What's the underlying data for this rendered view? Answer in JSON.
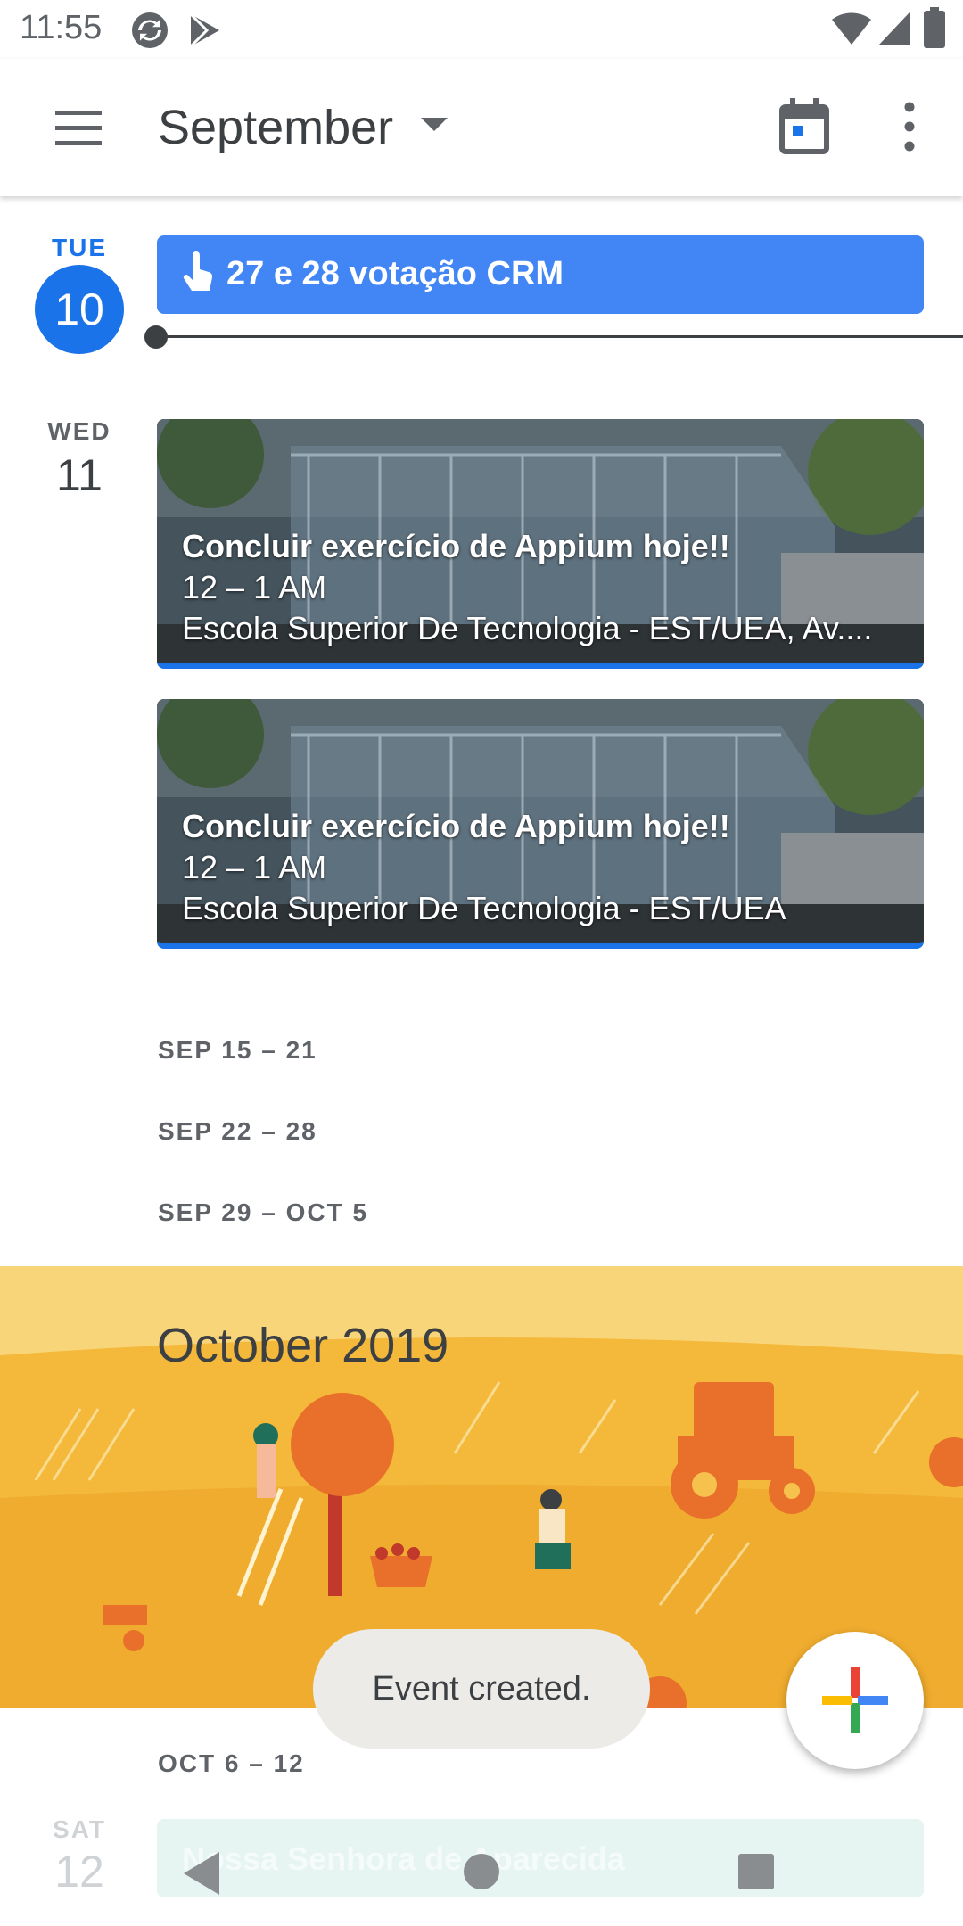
{
  "status_bar": {
    "time": "11:55"
  },
  "app_bar": {
    "month": "September"
  },
  "days": [
    {
      "dow": "TUE",
      "dom": "10",
      "is_today": true
    },
    {
      "dow": "WED",
      "dom": "11",
      "is_today": false
    }
  ],
  "events": {
    "tue_chip": {
      "title": "27 e 28 votação CRM",
      "color": "#4285f4"
    },
    "wed_cards": [
      {
        "title": "Concluir exercício de Appium hoje!!",
        "time": "12 – 1 AM",
        "location": "Escola Superior De Tecnologia - EST/UEA, Av...."
      },
      {
        "title": "Concluir exercício de Appium hoje!!",
        "time": "12 – 1 AM",
        "location": "Escola Superior De Tecnologia - EST/UEA"
      }
    ]
  },
  "weeks": [
    "SEP 15 – 21",
    "SEP 22 – 28",
    "SEP 29 – OCT 5"
  ],
  "october": {
    "title": "October 2019",
    "week": "OCT 6 – 12"
  },
  "bottom_partial": {
    "dow": "SAT",
    "dom": "12",
    "event": "Nossa Senhora de Aparecida"
  },
  "snackbar": {
    "message": "Event created."
  },
  "colors": {
    "accent": "#1a73e8",
    "chip": "#4285f4",
    "banner": "#f6c14d"
  },
  "icons": {
    "status": [
      "sync-icon",
      "play-store-icon",
      "wifi-icon",
      "signal-icon",
      "battery-icon"
    ],
    "app_bar": [
      "menu-icon",
      "dropdown-caret-icon",
      "calendar-today-icon",
      "more-vert-icon"
    ],
    "fab": "plus-icon",
    "nav": [
      "back-icon",
      "home-icon",
      "recents-icon"
    ]
  }
}
